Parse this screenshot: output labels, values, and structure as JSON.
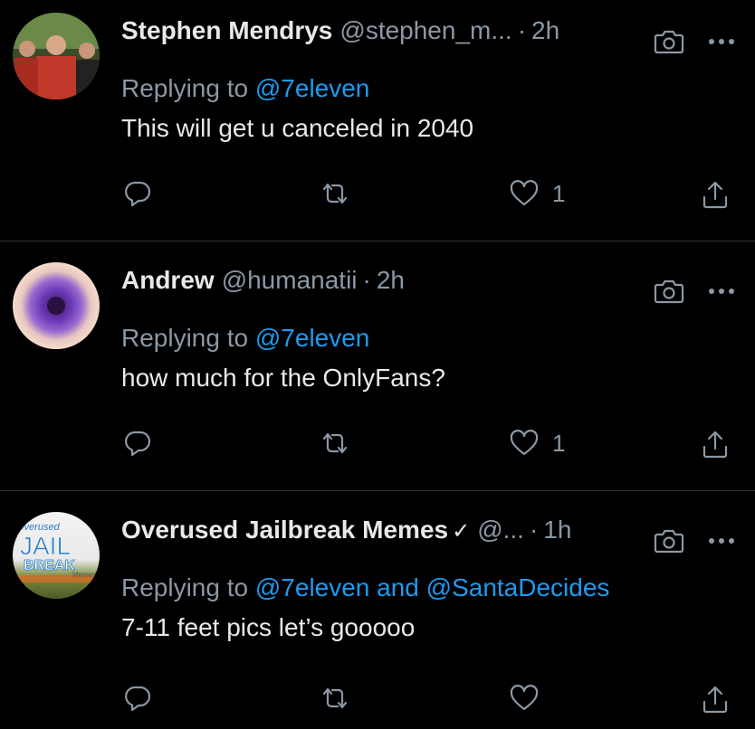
{
  "tweets": [
    {
      "name": "Stephen Mendrys",
      "verified": false,
      "handle": "@stephen_m...",
      "separator": "·",
      "time": "2h",
      "replying_prefix": "Replying to",
      "mentions": "@7eleven",
      "text": "This will get u canceled in 2040",
      "like_count": "1",
      "avatar_colors": [
        "#3d5a2a",
        "#c0392b"
      ]
    },
    {
      "name": "Andrew",
      "verified": false,
      "handle": "@humanatii",
      "separator": "·",
      "time": "2h",
      "replying_prefix": "Replying to",
      "mentions": "@7eleven",
      "text": "how much for the OnlyFans?",
      "like_count": "1",
      "avatar_colors": [
        "#f2d8c4",
        "#5b2c8f"
      ]
    },
    {
      "name": "Overused Jailbreak Memes",
      "verified": true,
      "verified_mark": "✓",
      "handle": "@...",
      "separator": "·",
      "time": "1h",
      "replying_prefix": "Replying to",
      "mentions": "@7eleven and @SantaDecides",
      "text": "7-11 feet pics let’s gooooo",
      "like_count": "",
      "avatar_text": [
        "Overused",
        "JAIL",
        "BREAK",
        "Memes"
      ],
      "avatar_colors": [
        "#2a7fc9",
        "#f0f0f0"
      ]
    }
  ],
  "icons": {
    "camera": "camera-icon",
    "more": "more-icon",
    "reply": "reply-icon",
    "retweet": "retweet-icon",
    "like": "heart-icon",
    "share": "share-icon"
  },
  "colors": {
    "background": "#000000",
    "text_primary": "#e7e9ea",
    "text_secondary": "#8b98a5",
    "link": "#1d9bf0",
    "divider": "#2f3336"
  }
}
